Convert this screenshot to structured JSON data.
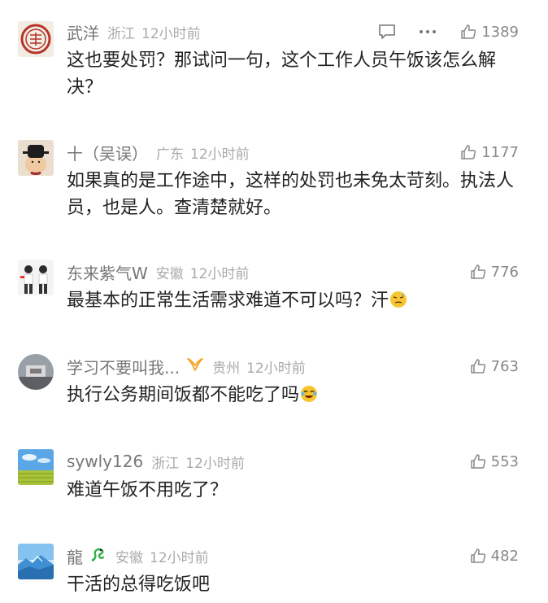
{
  "comments": [
    {
      "name": "武洋",
      "location": "浙江",
      "time": "12小时前",
      "likes": "1389",
      "text": "这也要处罚？那试问一句，这个工作人员午饭该怎么解决？"
    },
    {
      "name": "十（吴误）",
      "location": "广东",
      "time": "12小时前",
      "likes": "1177",
      "text": "如果真的是工作途中，这样的处罚也未免太苛刻。执法人员，也是人。查清楚就好。"
    },
    {
      "name": "东来紫气W",
      "location": "安徽",
      "time": "12小时前",
      "likes": "776",
      "text": "最基本的正常生活需求难道不可以吗？汗"
    },
    {
      "name": "学习不要叫我...",
      "location": "贵州",
      "time": "12小时前",
      "likes": "763",
      "text": "执行公务期间饭都不能吃了吗"
    },
    {
      "name": "sywly126",
      "location": "浙江",
      "time": "12小时前",
      "likes": "553",
      "text": "难道午饭不用吃了？"
    },
    {
      "name": "龍",
      "location": "安徽",
      "time": "12小时前",
      "likes": "482",
      "text": "干活的总得吃饭吧"
    }
  ],
  "icons": {
    "reply": "comment-bubble-icon",
    "more": "more-dots-icon",
    "like": "thumbs-up-icon",
    "sweat_emoji": "sweat-emoji-icon",
    "laugh_cry_emoji": "laugh-cry-emoji-icon",
    "vip_badge": "vip-badge-icon",
    "dragon_badge": "dragon-badge-icon"
  },
  "colors": {
    "name": "#777777",
    "meta": "#aaaaaa",
    "text": "#222222",
    "likes": "#888888",
    "badge_orange": "#f5a623",
    "badge_green": "#2db34a"
  }
}
